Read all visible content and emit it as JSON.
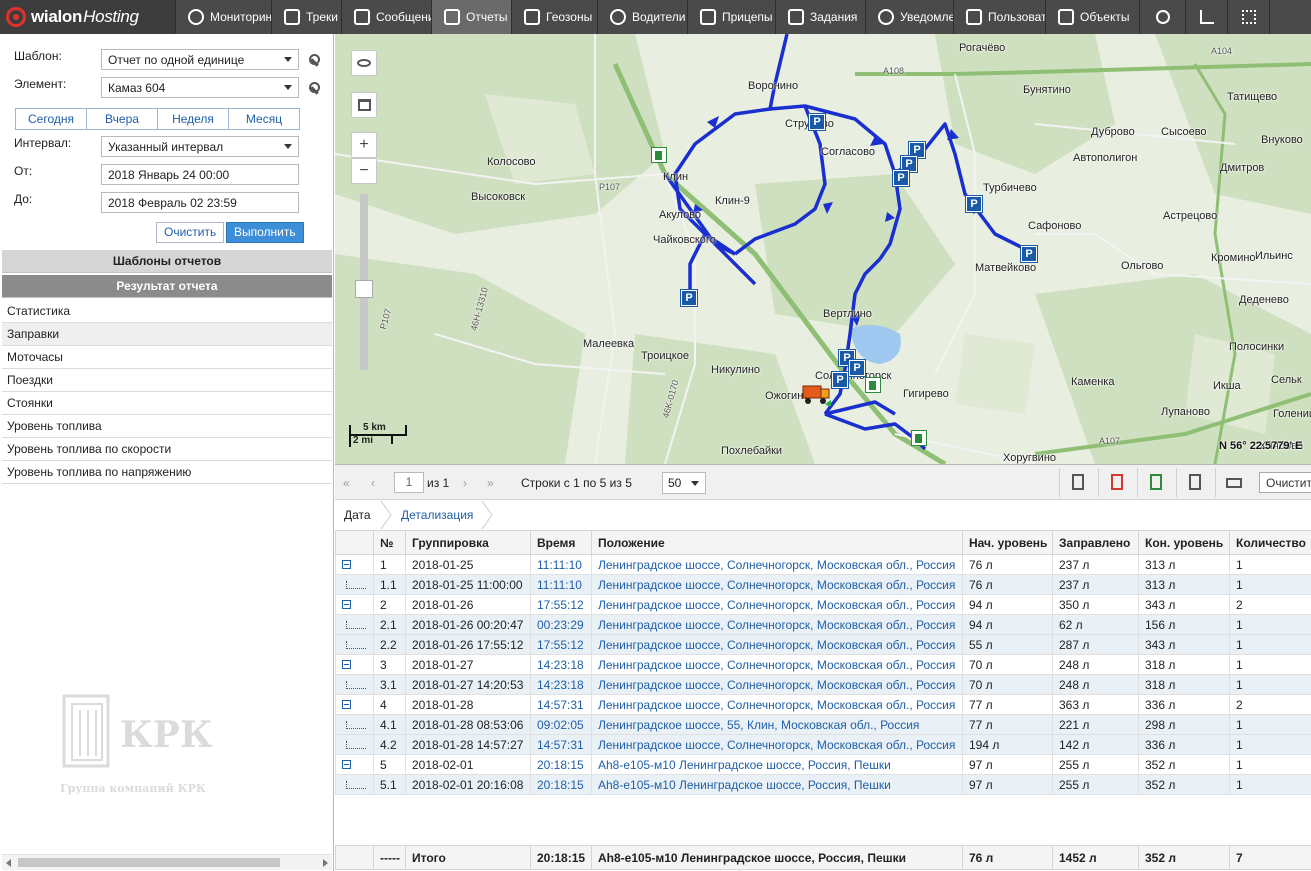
{
  "app": {
    "logo_text": "wialon",
    "logo_host": "Hosting"
  },
  "nav": {
    "items": [
      {
        "label": "Мониторинг",
        "icon": "globe-icon"
      },
      {
        "label": "Треки",
        "icon": "flag-icon"
      },
      {
        "label": "Сообщения",
        "icon": "messages-icon"
      },
      {
        "label": "Отчеты",
        "icon": "reports-icon"
      },
      {
        "label": "Геозоны",
        "icon": "geofence-icon"
      },
      {
        "label": "Водители",
        "icon": "driver-icon"
      },
      {
        "label": "Прицепы",
        "icon": "trailer-icon"
      },
      {
        "label": "Задания",
        "icon": "tasks-icon"
      },
      {
        "label": "Уведомления",
        "icon": "alarm-icon"
      },
      {
        "label": "Пользователи",
        "icon": "user-icon"
      },
      {
        "label": "Объекты",
        "icon": "bus-icon"
      }
    ],
    "active": "Отчеты",
    "right_icons": [
      "search-icon",
      "ruler-icon",
      "apps-grid-icon"
    ]
  },
  "report_form": {
    "template_label": "Шаблон:",
    "template_value": "Отчет по одной единице",
    "element_label": "Элемент:",
    "element_value": "Камаз 604",
    "period_tabs": [
      "Сегодня",
      "Вчера",
      "Неделя",
      "Месяц"
    ],
    "interval_label": "Интервал:",
    "interval_value": "Указанный интервал",
    "from_label": "От:",
    "from_value": "2018 Январь 24 00:00",
    "to_label": "До:",
    "to_value": "2018 Февраль 02 23:59",
    "clear_label": "Очистить",
    "run_label": "Выполнить"
  },
  "sections": {
    "templates": "Шаблоны отчетов",
    "result": "Результат отчета"
  },
  "result_items": [
    "Статистика",
    "Заправки",
    "Моточасы",
    "Поездки",
    "Стоянки",
    "Уровень топлива",
    "Уровень топлива по скорости",
    "Уровень топлива по напряжению"
  ],
  "result_selected": "Заправки",
  "watermark": {
    "title": "КРК",
    "subtitle": "Группа компаний КРК"
  },
  "map": {
    "towns": [
      "Рогачёво",
      "Воронино",
      "Бунятино",
      "Татищево",
      "Дуброво",
      "Сысоево",
      "Внуково",
      "Струбово",
      "Согласово",
      "Колосово",
      "Автополигон",
      "Дмитров",
      "Клин",
      "Клин-9",
      "Турбичево",
      "Высоковск",
      "Акулово",
      "Сафоново",
      "Астрецово",
      "Чайковского",
      "Матвейково",
      "Ольгово",
      "Кромино",
      "Ильинс",
      "Деденево",
      "Вертлино",
      "Малеевка",
      "Троицкое",
      "Полосинки",
      "Никулино",
      "Каменка",
      "Сельк",
      "Ожогино",
      "Гигирево",
      "Икша",
      "Лупаново",
      "Голенище",
      "Похлебайки",
      "Хоругвино",
      "Хлябово",
      "Солнечногорск"
    ],
    "road_labels": [
      "A108",
      "P107",
      "A104",
      "A107",
      "46H-13310",
      "46K-0170",
      "P107"
    ],
    "scale_km": "5 km",
    "scale_mi": "2 mi",
    "coords": "N 56° 22.5779' E",
    "parking_label": "P"
  },
  "pager": {
    "page": "1",
    "of_label": "из 1",
    "rows_label": "Строки с 1 по 5 из 5",
    "page_size": "50",
    "export_label": "Очистить"
  },
  "breadcrumbs": [
    "Дата",
    "Детализация"
  ],
  "table": {
    "columns": [
      "№",
      "Группировка",
      "Время",
      "Положение",
      "Нач. уровень",
      "Заправлено",
      "Кон. уровень",
      "Количество"
    ],
    "rows": [
      {
        "type": "group",
        "num": "1",
        "group": "2018-01-25",
        "time": "11:11:10",
        "place": "Ленинградское шоссе, Солнечногорск, Московская обл., Россия",
        "start": "76 л",
        "filled": "237 л",
        "end": "313 л",
        "count": "1"
      },
      {
        "type": "child",
        "num": "1.1",
        "group": "2018-01-25 11:00:00",
        "time": "11:11:10",
        "place": "Ленинградское шоссе, Солнечногорск, Московская обл., Россия",
        "start": "76 л",
        "filled": "237 л",
        "end": "313 л",
        "count": "1"
      },
      {
        "type": "group",
        "num": "2",
        "group": "2018-01-26",
        "time": "17:55:12",
        "place": "Ленинградское шоссе, Солнечногорск, Московская обл., Россия",
        "start": "94 л",
        "filled": "350 л",
        "end": "343 л",
        "count": "2"
      },
      {
        "type": "child",
        "num": "2.1",
        "group": "2018-01-26 00:20:47",
        "time": "00:23:29",
        "place": "Ленинградское шоссе, Солнечногорск, Московская обл., Россия",
        "start": "94 л",
        "filled": "62 л",
        "end": "156 л",
        "count": "1"
      },
      {
        "type": "child",
        "num": "2.2",
        "group": "2018-01-26 17:55:12",
        "time": "17:55:12",
        "place": "Ленинградское шоссе, Солнечногорск, Московская обл., Россия",
        "start": "55 л",
        "filled": "287 л",
        "end": "343 л",
        "count": "1"
      },
      {
        "type": "group",
        "num": "3",
        "group": "2018-01-27",
        "time": "14:23:18",
        "place": "Ленинградское шоссе, Солнечногорск, Московская обл., Россия",
        "start": "70 л",
        "filled": "248 л",
        "end": "318 л",
        "count": "1"
      },
      {
        "type": "child",
        "num": "3.1",
        "group": "2018-01-27 14:20:53",
        "time": "14:23:18",
        "place": "Ленинградское шоссе, Солнечногорск, Московская обл., Россия",
        "start": "70 л",
        "filled": "248 л",
        "end": "318 л",
        "count": "1"
      },
      {
        "type": "group",
        "num": "4",
        "group": "2018-01-28",
        "time": "14:57:31",
        "place": "Ленинградское шоссе, Солнечногорск, Московская обл., Россия",
        "start": "77 л",
        "filled": "363 л",
        "end": "336 л",
        "count": "2"
      },
      {
        "type": "child",
        "num": "4.1",
        "group": "2018-01-28 08:53:06",
        "time": "09:02:05",
        "place": "Ленинградское шоссе, 55, Клин, Московская обл., Россия",
        "start": "77 л",
        "filled": "221 л",
        "end": "298 л",
        "count": "1"
      },
      {
        "type": "child",
        "num": "4.2",
        "group": "2018-01-28 14:57:27",
        "time": "14:57:31",
        "place": "Ленинградское шоссе, Солнечногорск, Московская обл., Россия",
        "start": "194 л",
        "filled": "142 л",
        "end": "336 л",
        "count": "1"
      },
      {
        "type": "group",
        "num": "5",
        "group": "2018-02-01",
        "time": "20:18:15",
        "place": "Ah8-e105-м10 Ленинградское шоссе, Россия, Пешки",
        "start": "97 л",
        "filled": "255 л",
        "end": "352 л",
        "count": "1"
      },
      {
        "type": "child",
        "num": "5.1",
        "group": "2018-02-01 20:16:08",
        "time": "20:18:15",
        "place": "Ah8-e105-м10 Ленинградское шоссе, Россия, Пешки",
        "start": "97 л",
        "filled": "255 л",
        "end": "352 л",
        "count": "1"
      }
    ],
    "totals": {
      "num": "-----",
      "group": "Итого",
      "time": "20:18:15",
      "place": "Ah8-e105-м10 Ленинградское шоссе, Россия, Пешки",
      "start": "76 л",
      "filled": "1452 л",
      "end": "352 л",
      "count": "7"
    }
  },
  "colors": {
    "accent": "#3d8ed8",
    "track": "#1a2fcf",
    "parking": "#1a58a8",
    "topbar": "#4a4a4a"
  }
}
